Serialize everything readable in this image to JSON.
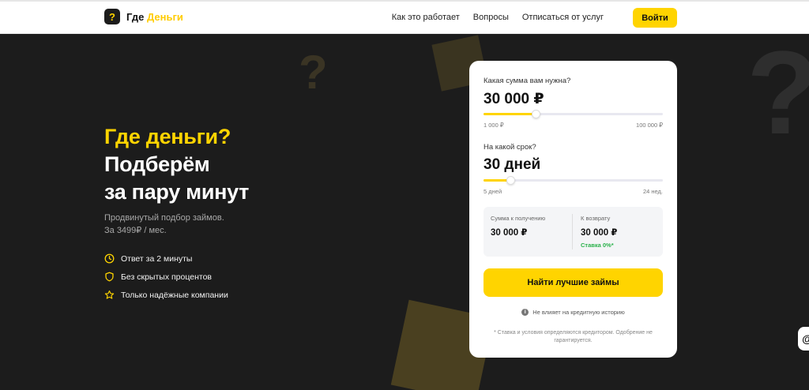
{
  "header": {
    "logo_mark": "?",
    "logo_word1": "Где",
    "logo_word2": "Деньги",
    "nav": [
      "Как это работает",
      "Вопросы",
      "Отписаться от услуг"
    ],
    "login_label": "Войти"
  },
  "decor": {
    "qmark": "?"
  },
  "hero": {
    "title_line1": "Где деньги?",
    "title_line2": "Подберём",
    "title_line3": "за пару минут",
    "subtitle_line1": "Продвинутый подбор займов.",
    "subtitle_line2": "За 3499₽ / мес.",
    "features": [
      {
        "icon": "clock-icon",
        "label": "Ответ за 2 минуты"
      },
      {
        "icon": "shield-icon",
        "label": "Без скрытых процентов"
      },
      {
        "icon": "star-icon",
        "label": "Только надёжные компании"
      }
    ]
  },
  "calculator": {
    "amount_label": "Какая сумма вам нужна?",
    "amount_value": "30 000 ₽",
    "amount_min": "1 000 ₽",
    "amount_max": "100 000 ₽",
    "amount_fraction": 0.29,
    "term_label": "На какой срок?",
    "term_value": "30 дней",
    "term_min": "5 дней",
    "term_max": "24 нед.",
    "term_fraction": 0.15,
    "receive_label": "Сумма к получению",
    "receive_value": "30 000 ₽",
    "return_label": "К возврату",
    "return_value": "30 000 ₽",
    "rate_text": "Ставка 0%*",
    "cta_label": "Найти лучшие займы",
    "notice_icon": "info-icon",
    "notice_text": "Не влияет на кредитную историю",
    "disclaimer": "* Ставка и условия определяются кредитором. Одобрение не гарантируется."
  },
  "side_widget": {
    "icon": "at-icon",
    "glyph": "@"
  },
  "colors": {
    "accent": "#ffd400",
    "background": "#1c1c1c",
    "card": "#ffffff",
    "rate_green": "#2bb24c"
  }
}
